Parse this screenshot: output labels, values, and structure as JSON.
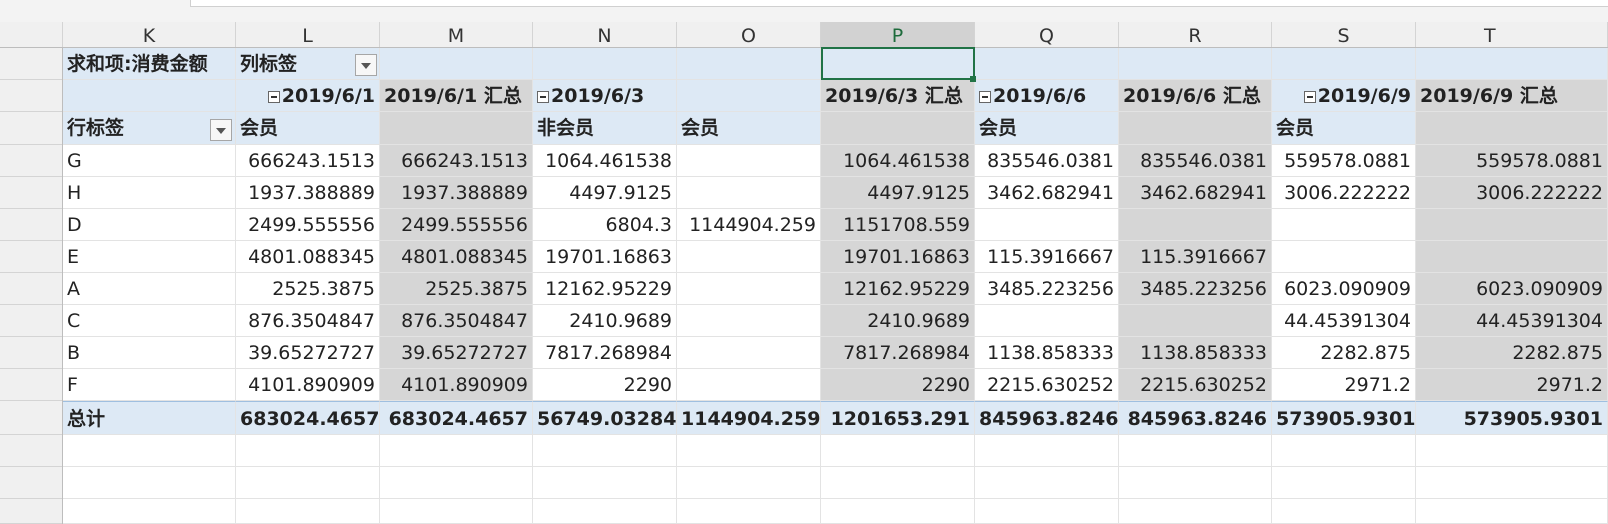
{
  "columns": [
    "K",
    "L",
    "M",
    "N",
    "O",
    "P",
    "Q",
    "R",
    "S",
    "T"
  ],
  "selected_column": "P",
  "pivot": {
    "value_field": "求和项:消费金额",
    "col_labels_caption": "列标签",
    "row_labels_caption": "行标签",
    "date_headers": {
      "L": "2019/6/1",
      "M": "2019/6/1 汇总",
      "N": "2019/6/3",
      "P": "2019/6/3 汇总",
      "Q": "2019/6/6",
      "R": "2019/6/6 汇总",
      "S": "2019/6/9",
      "T": "2019/6/9 汇总"
    },
    "member_headers": {
      "L": "会员",
      "N": "非会员",
      "O": "会员",
      "Q": "会员",
      "S": "会员"
    },
    "rows": [
      {
        "label": "G",
        "L": "666243.1513",
        "M": "666243.1513",
        "N": "1064.461538",
        "O": "",
        "P": "1064.461538",
        "Q": "835546.0381",
        "R": "835546.0381",
        "S": "559578.0881",
        "T": "559578.0881"
      },
      {
        "label": "H",
        "L": "1937.388889",
        "M": "1937.388889",
        "N": "4497.9125",
        "O": "",
        "P": "4497.9125",
        "Q": "3462.682941",
        "R": "3462.682941",
        "S": "3006.222222",
        "T": "3006.222222"
      },
      {
        "label": "D",
        "L": "2499.555556",
        "M": "2499.555556",
        "N": "6804.3",
        "O": "1144904.259",
        "P": "1151708.559",
        "Q": "",
        "R": "",
        "S": "",
        "T": ""
      },
      {
        "label": "E",
        "L": "4801.088345",
        "M": "4801.088345",
        "N": "19701.16863",
        "O": "",
        "P": "19701.16863",
        "Q": "115.3916667",
        "R": "115.3916667",
        "S": "",
        "T": ""
      },
      {
        "label": "A",
        "L": "2525.3875",
        "M": "2525.3875",
        "N": "12162.95229",
        "O": "",
        "P": "12162.95229",
        "Q": "3485.223256",
        "R": "3485.223256",
        "S": "6023.090909",
        "T": "6023.090909"
      },
      {
        "label": "C",
        "L": "876.3504847",
        "M": "876.3504847",
        "N": "2410.9689",
        "O": "",
        "P": "2410.9689",
        "Q": "",
        "R": "",
        "S": "44.45391304",
        "T": "44.45391304"
      },
      {
        "label": "B",
        "L": "39.65272727",
        "M": "39.65272727",
        "N": "7817.268984",
        "O": "",
        "P": "7817.268984",
        "Q": "1138.858333",
        "R": "1138.858333",
        "S": "2282.875",
        "T": "2282.875"
      },
      {
        "label": "F",
        "L": "4101.890909",
        "M": "4101.890909",
        "N": "2290",
        "O": "",
        "P": "2290",
        "Q": "2215.630252",
        "R": "2215.630252",
        "S": "2971.2",
        "T": "2971.2"
      }
    ],
    "total": {
      "label": "总计",
      "L": "683024.4657",
      "M": "683024.4657",
      "N": "56749.03284",
      "O": "1144904.259",
      "P": "1201653.291",
      "Q": "845963.8246",
      "R": "845963.8246",
      "S": "573905.9301",
      "T": "573905.9301"
    }
  }
}
